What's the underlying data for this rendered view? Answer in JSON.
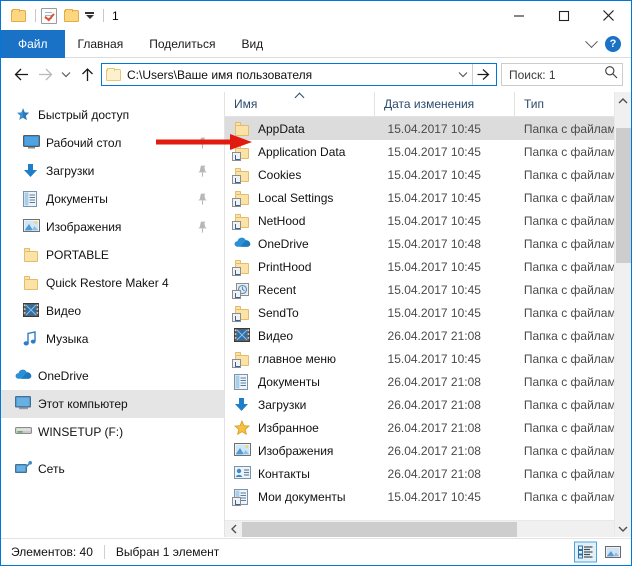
{
  "titlebar": {
    "title": "1",
    "quick_access_icons": [
      "folder-icon",
      "properties-checklist-icon",
      "folder-dropdown-icon"
    ],
    "minimize_label": "—",
    "maximize_label": "□",
    "close_label": "✕"
  },
  "ribbon": {
    "tabs": [
      {
        "label": "Файл",
        "active_blue": true
      },
      {
        "label": "Главная",
        "active_blue": false
      },
      {
        "label": "Поделиться",
        "active_blue": false
      },
      {
        "label": "Вид",
        "active_blue": false
      }
    ],
    "expand_icon": "chevron-down-icon",
    "help_label": "?"
  },
  "address": {
    "back_icon": "back-arrow-icon",
    "forward_icon": "forward-arrow-icon",
    "recent_icon": "chevron-down-icon",
    "up_icon": "up-arrow-icon",
    "path": "C:\\Users\\Ваше имя пользователя",
    "folder_icon": "folder-icon",
    "dropdown_icon": "chevron-down-icon",
    "go_icon": "go-arrow-icon",
    "search_value": "Поиск: 1",
    "search_placeholder": "Поиск",
    "search_icon": "search-icon"
  },
  "sidebar": {
    "items": [
      {
        "label": "Быстрый доступ",
        "icon": "star-pin-icon",
        "level": "root",
        "pinned": false,
        "selected": false
      },
      {
        "label": "Рабочий стол",
        "icon": "desktop-icon",
        "level": "child",
        "pinned": true,
        "selected": false
      },
      {
        "label": "Загрузки",
        "icon": "downloads-icon",
        "level": "child",
        "pinned": true,
        "selected": false
      },
      {
        "label": "Документы",
        "icon": "documents-icon",
        "level": "child",
        "pinned": true,
        "selected": false
      },
      {
        "label": "Изображения",
        "icon": "pictures-icon",
        "level": "child",
        "pinned": true,
        "selected": false
      },
      {
        "label": "PORTABLE",
        "icon": "folder-icon",
        "level": "child",
        "pinned": false,
        "selected": false
      },
      {
        "label": "Quick Restore Maker 4",
        "icon": "folder-icon",
        "level": "child",
        "pinned": false,
        "selected": false
      },
      {
        "label": "Видео",
        "icon": "video-icon",
        "level": "child",
        "pinned": false,
        "selected": false
      },
      {
        "label": "Музыка",
        "icon": "music-icon",
        "level": "child",
        "pinned": false,
        "selected": false
      },
      {
        "label": "OneDrive",
        "icon": "onedrive-cloud-icon",
        "level": "root",
        "pinned": false,
        "selected": false
      },
      {
        "label": "Этот компьютер",
        "icon": "this-pc-icon",
        "level": "root",
        "pinned": false,
        "selected": true
      },
      {
        "label": "WINSETUP (F:)",
        "icon": "drive-icon",
        "level": "root",
        "pinned": false,
        "selected": false
      },
      {
        "label": "Сеть",
        "icon": "network-icon",
        "level": "root",
        "pinned": false,
        "selected": false
      }
    ]
  },
  "filelist": {
    "columns": [
      {
        "label": "Имя",
        "sorted": "asc"
      },
      {
        "label": "Дата изменения",
        "sorted": "none"
      },
      {
        "label": "Тип",
        "sorted": "none"
      }
    ],
    "rows": [
      {
        "name": "AppData",
        "date": "15.04.2017 10:45",
        "type": "Папка с файлами",
        "icon": "folder-icon",
        "shortcut": false,
        "selected": true
      },
      {
        "name": "Application Data",
        "date": "15.04.2017 10:45",
        "type": "Папка с файлами",
        "icon": "folder-icon",
        "shortcut": true,
        "selected": false
      },
      {
        "name": "Cookies",
        "date": "15.04.2017 10:45",
        "type": "Папка с файлами",
        "icon": "folder-icon",
        "shortcut": true,
        "selected": false
      },
      {
        "name": "Local Settings",
        "date": "15.04.2017 10:45",
        "type": "Папка с файлами",
        "icon": "folder-icon",
        "shortcut": true,
        "selected": false
      },
      {
        "name": "NetHood",
        "date": "15.04.2017 10:45",
        "type": "Папка с файлами",
        "icon": "folder-icon",
        "shortcut": true,
        "selected": false
      },
      {
        "name": "OneDrive",
        "date": "15.04.2017 10:48",
        "type": "Папка с файлами",
        "icon": "onedrive-cloud-icon",
        "shortcut": false,
        "selected": false
      },
      {
        "name": "PrintHood",
        "date": "15.04.2017 10:45",
        "type": "Папка с файлами",
        "icon": "folder-icon",
        "shortcut": true,
        "selected": false
      },
      {
        "name": "Recent",
        "date": "15.04.2017 10:45",
        "type": "Папка с файлами",
        "icon": "recent-icon",
        "shortcut": true,
        "selected": false
      },
      {
        "name": "SendTo",
        "date": "15.04.2017 10:45",
        "type": "Папка с файлами",
        "icon": "folder-icon",
        "shortcut": true,
        "selected": false
      },
      {
        "name": "Видео",
        "date": "26.04.2017 21:08",
        "type": "Папка с файлами",
        "icon": "video-icon",
        "shortcut": false,
        "selected": false
      },
      {
        "name": "главное меню",
        "date": "15.04.2017 10:45",
        "type": "Папка с файлами",
        "icon": "folder-icon",
        "shortcut": true,
        "selected": false
      },
      {
        "name": "Документы",
        "date": "26.04.2017 21:08",
        "type": "Папка с файлами",
        "icon": "documents-icon",
        "shortcut": false,
        "selected": false
      },
      {
        "name": "Загрузки",
        "date": "26.04.2017 21:08",
        "type": "Папка с файлами",
        "icon": "downloads-icon",
        "shortcut": false,
        "selected": false
      },
      {
        "name": "Избранное",
        "date": "26.04.2017 21:08",
        "type": "Папка с файлами",
        "icon": "favorites-star-icon",
        "shortcut": false,
        "selected": false
      },
      {
        "name": "Изображения",
        "date": "26.04.2017 21:08",
        "type": "Папка с файлами",
        "icon": "pictures-icon",
        "shortcut": false,
        "selected": false
      },
      {
        "name": "Контакты",
        "date": "26.04.2017 21:08",
        "type": "Папка с файлами",
        "icon": "contacts-icon",
        "shortcut": false,
        "selected": false
      },
      {
        "name": "Мои документы",
        "date": "15.04.2017 10:45",
        "type": "Папка с файлами",
        "icon": "documents-icon",
        "shortcut": true,
        "selected": false
      }
    ]
  },
  "statusbar": {
    "item_count": "Элементов: 40",
    "selection": "Выбран 1 элемент",
    "view_details_icon": "details-view-icon",
    "view_tiles_icon": "large-icons-view-icon"
  },
  "annotation": {
    "arrow": "red-pointer-arrow",
    "color": "#e01b10"
  },
  "colors": {
    "accent": "#0078d7",
    "file_tab": "#1a72c6",
    "selection": "#dcdcdc",
    "nav_selection": "#e5e5e5",
    "folder": "#fcd77f"
  }
}
